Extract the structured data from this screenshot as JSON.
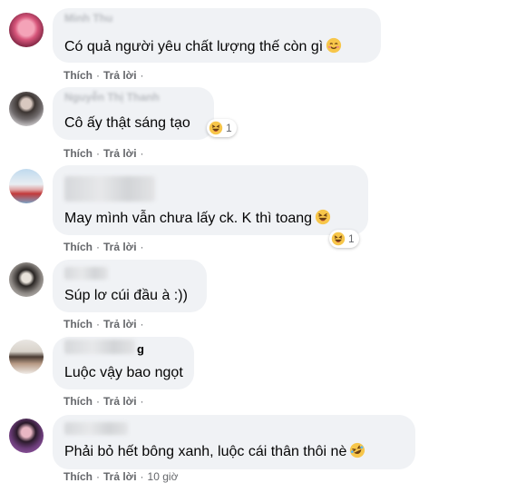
{
  "actions": {
    "like": "Thích",
    "reply": "Trả lời",
    "dot": "·"
  },
  "comments": [
    {
      "name": "Minh Thu",
      "text": "Có quả người yêu chất lượng thế còn gì",
      "emoji": "smiling-face-icon"
    },
    {
      "name": "Nguyễn Thị Thanh",
      "text": "Cô ấy thật sáng tạo",
      "reaction_count": "1"
    },
    {
      "text": "May mình vẫn chưa lấy ck. K thì toang",
      "emoji": "laughing-face-icon",
      "reaction_count": "1"
    },
    {
      "text": "Súp lơ cúi đầu à :))"
    },
    {
      "name": "g",
      "text": "Luộc vậy bao ngọt"
    },
    {
      "text": "Phải bỏ hết bông xanh, luộc cái thân thôi nè",
      "emoji": "rolling-laughing-icon"
    }
  ],
  "last_time": "10 giờ",
  "colors": {
    "bubble": "#f0f2f5",
    "action_text": "#65676b",
    "emoji_yellow": "#f7c64a"
  }
}
